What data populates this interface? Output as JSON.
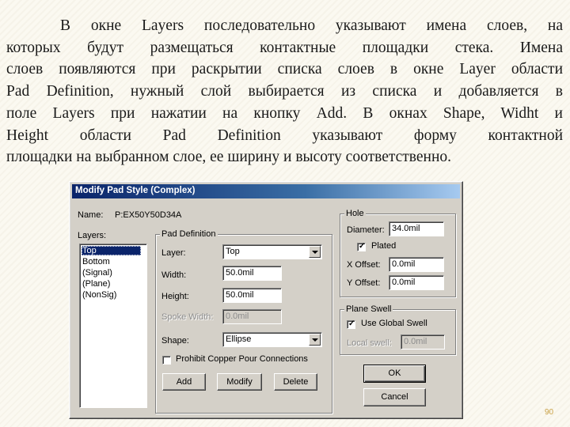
{
  "slide": {
    "paragraph_lines": [
      "В окне Layers последовательно указывают имена слоев, на",
      "которых будут размещаться контактные площадки стека. Имена",
      "слоев появляются при раскрытии списка слоев в окне Layer области",
      "Pad Definition, нужный слой выбирается из списка и добавляется в",
      "поле Layers при нажатии на кнопку Add. В окнах Shape, Widht и",
      "Height области Pad Definition указывают форму контактной",
      "площадки на выбранном слое, ее ширину и высоту соответственно."
    ],
    "page_number": "90"
  },
  "dialog": {
    "title": "Modify Pad Style (Complex)",
    "name_label": "Name:",
    "name_value": "P:EX50Y50D34A",
    "layers_label": "Layers:",
    "layers_list": [
      "Top",
      "Bottom",
      "(Signal)",
      "(Plane)",
      "(NonSig)"
    ],
    "selected_layer_index": 0,
    "pad_definition": {
      "group_label": "Pad Definition",
      "layer_label": "Layer:",
      "layer_value": "Top",
      "width_label": "Width:",
      "width_value": "50.0mil",
      "height_label": "Height:",
      "height_value": "50.0mil",
      "spoke_label": "Spoke Width:",
      "spoke_value": "0.0mil",
      "shape_label": "Shape:",
      "shape_value": "Ellipse",
      "prohibit_label": "Prohibit Copper Pour Connections",
      "prohibit_checked": false
    },
    "buttons": {
      "add": "Add",
      "modify": "Modify",
      "delete": "Delete",
      "ok": "OK",
      "cancel": "Cancel"
    },
    "hole": {
      "group_label": "Hole",
      "diameter_label": "Diameter:",
      "diameter_value": "34.0mil",
      "plated_label": "Plated",
      "plated_checked": true,
      "x_offset_label": "X Offset:",
      "x_offset_value": "0.0mil",
      "y_offset_label": "Y Offset:",
      "y_offset_value": "0.0mil"
    },
    "plane_swell": {
      "group_label": "Plane Swell",
      "use_global_label": "Use Global Swell",
      "use_global_checked": true,
      "local_swell_label": "Local swell:",
      "local_swell_value": "0.0mil"
    }
  }
}
